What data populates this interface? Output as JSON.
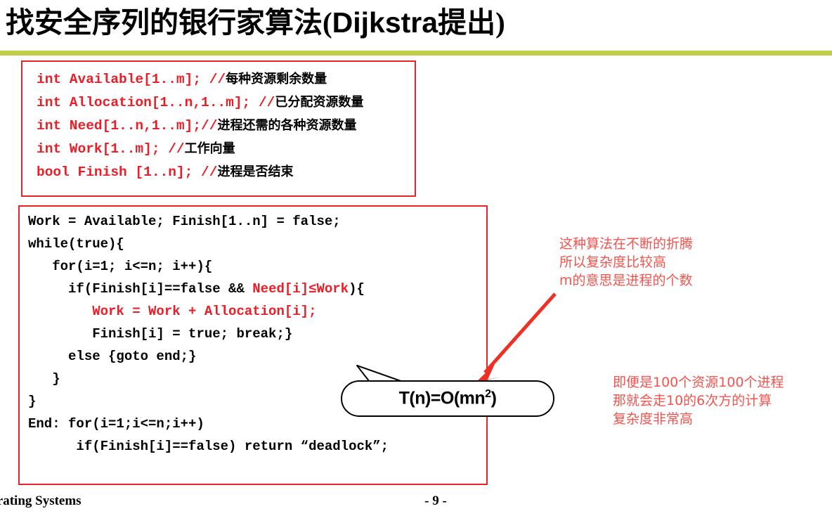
{
  "slide": {
    "title_cjk_1": "找安全序列的银行家算法(",
    "title_latin": "Dijkstra",
    "title_cjk_2": "提出)",
    "title_full": "找安全序列的银行家算法(Dijkstra提出)",
    "accent_bar_color": "#c3cc47",
    "code_border_color": "#e8242a",
    "code_red_color": "#ee1c25",
    "annotation_color": "#f4534d",
    "arrow_color": "#ee3124"
  },
  "declarations_box": {
    "lines": [
      {
        "code": "int Available[1..m]; ",
        "comment": "//每种资源剩余数量",
        "code_color": "red"
      },
      {
        "code": "int Allocation[1..n,1..m]; ",
        "comment": "//已分配资源数量",
        "code_color": "red"
      },
      {
        "code": "int Need[1..n,1..m];",
        "comment": "//进程还需的各种资源数量",
        "code_color": "red"
      },
      {
        "code": "int Work[1..m]; ",
        "comment": "//工作向量",
        "code_color": "red"
      },
      {
        "code": "bool Finish [1..n]; ",
        "comment": "//进程是否结束",
        "code_color": "red"
      }
    ]
  },
  "algorithm_box": {
    "lines": [
      {
        "black_1": "Work = Available; Finish[1..n] = false;",
        "red": "",
        "black_2": ""
      },
      {
        "black_1": "while(true){",
        "red": "",
        "black_2": ""
      },
      {
        "black_1": "   for(i=1; i<=n; i++){",
        "red": "",
        "black_2": ""
      },
      {
        "black_1": "     if(Finish[i]==false && ",
        "red": "Need[i]≤Work",
        "black_2": "){"
      },
      {
        "black_1": "        ",
        "red": "Work = Work + Allocation[i];",
        "black_2": ""
      },
      {
        "black_1": "        Finish[i] = true; break;}",
        "red": "",
        "black_2": ""
      },
      {
        "black_1": "     else {goto end;}",
        "red": "",
        "black_2": ""
      },
      {
        "black_1": "   }",
        "red": "",
        "black_2": ""
      },
      {
        "black_1": "}",
        "red": "",
        "black_2": ""
      },
      {
        "black_1": "End: for(i=1;i<=n;i++)",
        "red": "",
        "black_2": ""
      },
      {
        "black_1": "      if(Finish[i]==false) return “deadlock”;",
        "red": "",
        "black_2": ""
      }
    ]
  },
  "callout": {
    "base": "T(n)=O(mn",
    "superscript": "2",
    "suffix": ")",
    "full_text": "T(n)=O(mn2)"
  },
  "annotations": {
    "top": {
      "line1": "这种算法在不断的折腾",
      "line2": "所以复杂度比较高",
      "line3": "m的意思是进程的个数"
    },
    "bottom": {
      "line1": "即便是100个资源100个进程",
      "line2": "那就会走10的6次方的计算",
      "line3": "复杂度非常高"
    }
  },
  "footer": {
    "left_label": "Operating Systems",
    "page_number": "- 9 -"
  }
}
